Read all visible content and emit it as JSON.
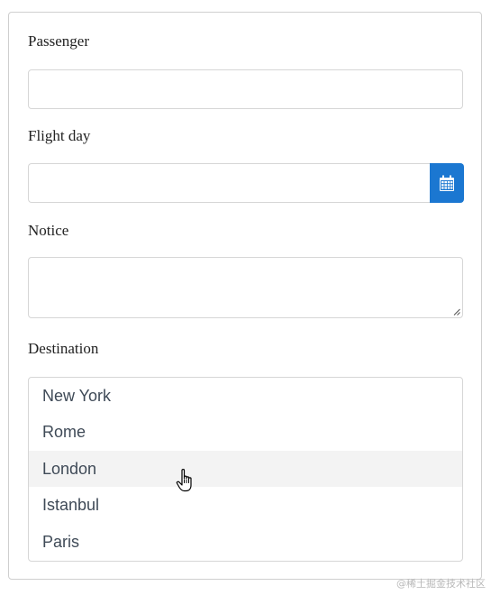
{
  "form": {
    "passenger_label": "Passenger",
    "passenger_value": "",
    "flight_day_label": "Flight day",
    "flight_day_value": "",
    "calendar_icon": "calendar-icon",
    "notice_label": "Notice",
    "notice_value": "",
    "destination_label": "Destination",
    "destinations": [
      "New York",
      "Rome",
      "London",
      "Istanbul",
      "Paris"
    ],
    "hovered_destination": "London"
  },
  "colors": {
    "accent": "#1b77d1",
    "hover_bg": "#f3f3f3",
    "border": "#d6d6d6"
  },
  "watermark": "@稀土掘金技术社区"
}
